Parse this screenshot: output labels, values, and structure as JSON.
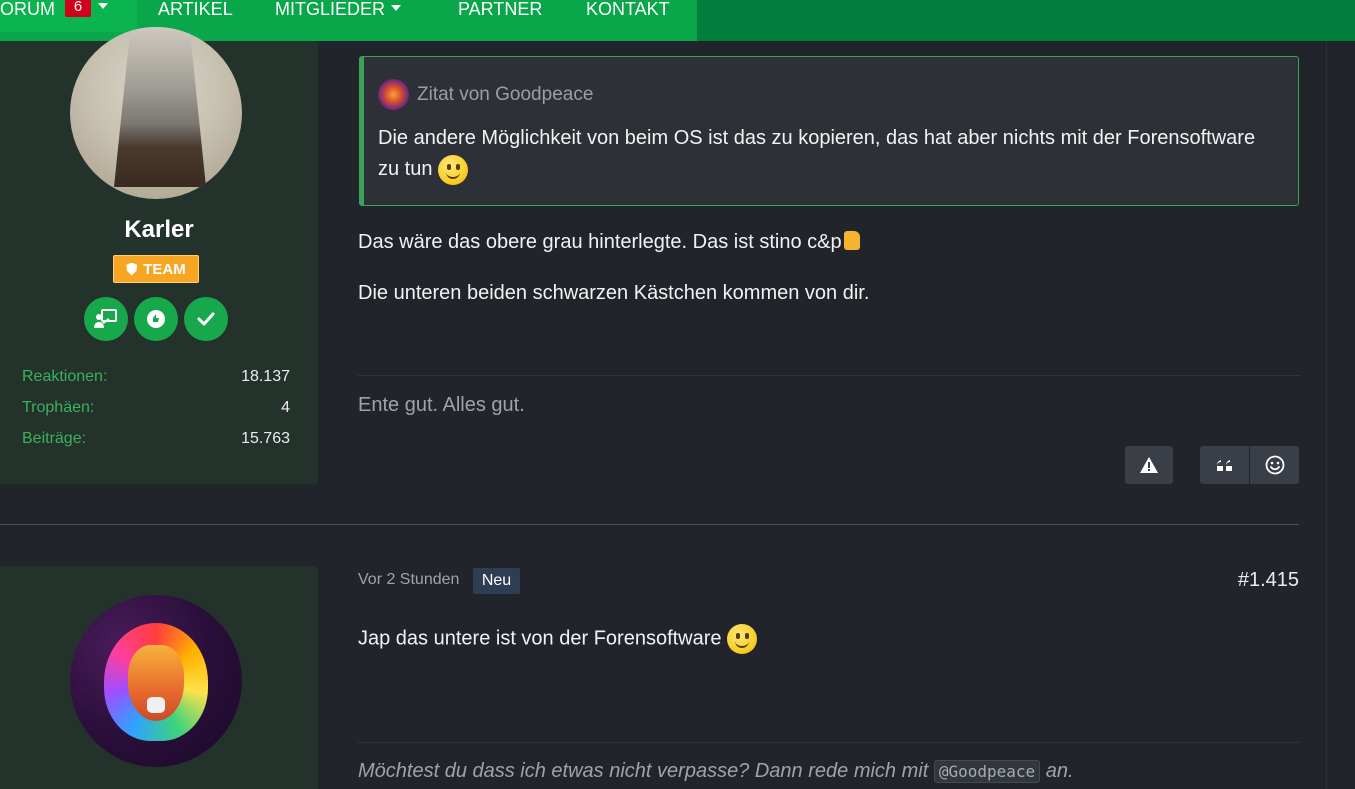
{
  "nav": {
    "items": [
      {
        "label": "ORUM",
        "badge": "6",
        "has_caret": true
      },
      {
        "label": "ARTIKEL",
        "has_caret": false
      },
      {
        "label": "MITGLIEDER",
        "has_caret": true
      },
      {
        "label": "PARTNER",
        "has_caret": false
      },
      {
        "label": "KONTAKT",
        "has_caret": false
      }
    ],
    "colors": {
      "bar": "#007d3a",
      "active": "#0aa64a",
      "badge": "#d0021b"
    }
  },
  "post1": {
    "author": {
      "name": "Karler",
      "role_badge": "TEAM",
      "trophies": [
        "presenter-icon",
        "like-icon",
        "check-icon"
      ],
      "stats": [
        {
          "label": "Reaktionen:",
          "value": "18.137"
        },
        {
          "label": "Trophäen:",
          "value": "4"
        },
        {
          "label": "Beiträge:",
          "value": "15.763"
        }
      ]
    },
    "quote": {
      "author": "Zitat von Goodpeace",
      "text": "Die andere Möglichkeit von beim OS ist das zu kopieren, das hat aber nichts mit der Forensoftware zu tun"
    },
    "body": [
      "Das wäre das obere grau hinterlegte. Das ist stino c&p",
      "Die unteren beiden schwarzen Kästchen kommen von dir."
    ],
    "signature": "Ente gut. Alles gut.",
    "actions": {
      "report": "warning-icon",
      "quote": "quote-icon",
      "react": "smiley-icon"
    }
  },
  "post2": {
    "time": "Vor 2 Stunden",
    "new_badge": "Neu",
    "number": "#1.415",
    "body": "Jap das untere ist von der Forensoftware",
    "signature": {
      "before": "Möchtest du dass ich etwas nicht verpasse? Dann rede mich mit",
      "mention": "@Goodpeace",
      "after": "an."
    }
  }
}
